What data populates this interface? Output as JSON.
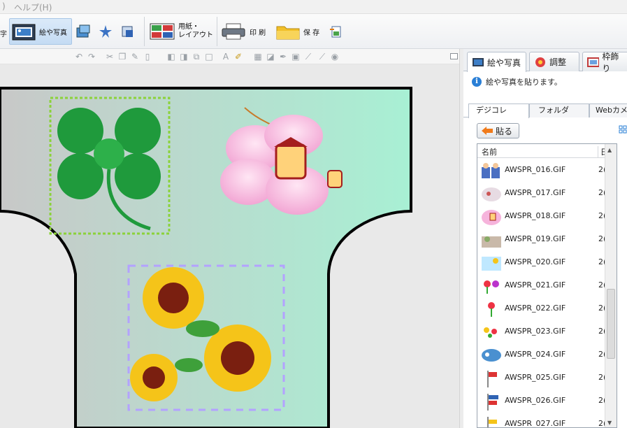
{
  "menubar": {
    "items": [
      "ヘルプ(H)"
    ]
  },
  "ribbon": {
    "partial_label": "字",
    "picture_button": "絵や写真",
    "paper_layout": [
      "用紙・",
      "レイアウト"
    ],
    "print": "印 刷",
    "save": "保 存"
  },
  "panel": {
    "tabs": [
      "絵や写真",
      "調整",
      "枠飾り"
    ],
    "info": "絵や写真を貼ります。",
    "subtabs": [
      "デジコレ",
      "フォルダ",
      "Webカメ"
    ],
    "paste_button": "貼る",
    "columns": {
      "name": "名前",
      "date": "日"
    },
    "files": [
      {
        "name": "AWSPR_016.GIF",
        "date": "2("
      },
      {
        "name": "AWSPR_017.GIF",
        "date": "2("
      },
      {
        "name": "AWSPR_018.GIF",
        "date": "2("
      },
      {
        "name": "AWSPR_019.GIF",
        "date": "2("
      },
      {
        "name": "AWSPR_020.GIF",
        "date": "2("
      },
      {
        "name": "AWSPR_021.GIF",
        "date": "2("
      },
      {
        "name": "AWSPR_022.GIF",
        "date": "2("
      },
      {
        "name": "AWSPR_023.GIF",
        "date": "2("
      },
      {
        "name": "AWSPR_024.GIF",
        "date": "2("
      },
      {
        "name": "AWSPR_025.GIF",
        "date": "2("
      },
      {
        "name": "AWSPR_026.GIF",
        "date": "2("
      },
      {
        "name": "AWSPR_027.GIF",
        "date": "2("
      }
    ]
  },
  "colors": {
    "accent": "#2a7fd6",
    "canvas_mint": "#a8f0d4",
    "canvas_grey": "#c8c8c8"
  }
}
